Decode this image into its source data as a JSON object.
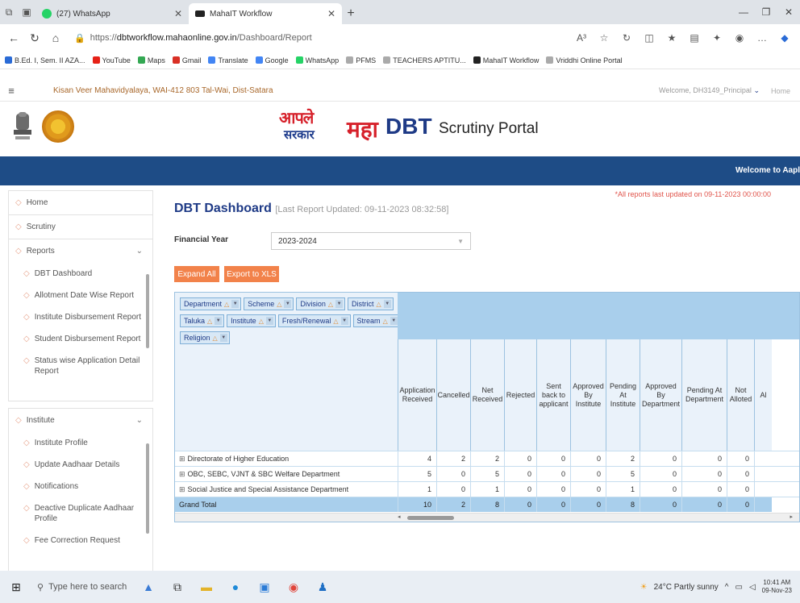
{
  "browser": {
    "tabs": [
      {
        "title": "(27) WhatsApp",
        "fav_color": "#25d366"
      },
      {
        "title": "MahaIT Workflow",
        "fav_color": "#222222"
      }
    ],
    "url_prefix": "https://",
    "url_host": "dbtworkflow.mahaonline.gov.in",
    "url_path": "/Dashboard/Report",
    "read_aloud": "A³",
    "bookmarks": [
      {
        "label": "B.Ed. I, Sem. II AZA...",
        "color": "#2a6bd6"
      },
      {
        "label": "YouTube",
        "color": "#e62117"
      },
      {
        "label": "Maps",
        "color": "#34a853"
      },
      {
        "label": "Gmail",
        "color": "#d93025"
      },
      {
        "label": "Translate",
        "color": "#4285f4"
      },
      {
        "label": "Google",
        "color": "#4285f4"
      },
      {
        "label": "WhatsApp",
        "color": "#25d366"
      },
      {
        "label": "PFMS",
        "color": "#aaaaaa"
      },
      {
        "label": "TEACHERS APTITU...",
        "color": "#aaaaaa"
      },
      {
        "label": "MahaIT Workflow",
        "color": "#222222"
      },
      {
        "label": "Vriddhi Online Portal",
        "color": "#aaaaaa"
      }
    ]
  },
  "header": {
    "college": "Kisan Veer Mahavidyalaya, WAI-412 803 Tal-Wai, Dist-Satara",
    "welcome": "Welcome, DH3149_Principal",
    "home": "Home",
    "logo_line1": "आपले",
    "logo_line2": "सरकार",
    "logo_maha": "महा",
    "logo_dbt": "DBT",
    "portal_name": "Scrutiny Portal",
    "marquee": "Welcome to Aapl"
  },
  "sidebar": {
    "home": "Home",
    "scrutiny": "Scrutiny",
    "reports": "Reports",
    "report_items": [
      "DBT Dashboard",
      "Allotment Date Wise Report",
      "Institute Disbursement Report",
      "Student Disbursement Report",
      "Status wise Application Detail Report"
    ],
    "institute": "Institute",
    "institute_items": [
      "Institute Profile",
      "Update Aadhaar Details",
      "Notifications",
      "Deactive Duplicate Aadhaar Profile",
      "Fee Correction Request"
    ]
  },
  "main": {
    "note": "*All reports last updated on 09-11-2023 00:00:00",
    "title": "DBT Dashboard",
    "subtitle": "[Last Report Updated: 09-11-2023 08:32:58]",
    "fy_label": "Financial Year",
    "fy_value": "2023-2024",
    "expand_all": "Expand All",
    "export": "Export to XLS"
  },
  "pivot": {
    "filters_row1": [
      "Department",
      "Scheme",
      "Division",
      "District"
    ],
    "filters_row2": [
      "Taluka",
      "Institute",
      "Fresh/Renewal",
      "Stream"
    ],
    "filters_row3": [
      "Religion"
    ],
    "columns": [
      "Application Received",
      "Cancelled",
      "Net Received",
      "Rejected",
      "Sent back to applicant",
      "Approved By Institute",
      "Pending At Institute",
      "Approved By Department",
      "Pending At Department",
      "Not Alloted",
      "Al"
    ],
    "rows": [
      {
        "label": "Directorate of Higher Education",
        "values": [
          "4",
          "2",
          "2",
          "0",
          "0",
          "0",
          "2",
          "0",
          "0",
          "0",
          ""
        ]
      },
      {
        "label": "OBC, SEBC, VJNT & SBC Welfare Department",
        "values": [
          "5",
          "0",
          "5",
          "0",
          "0",
          "0",
          "5",
          "0",
          "0",
          "0",
          ""
        ]
      },
      {
        "label": "Social Justice and Special Assistance Department",
        "values": [
          "1",
          "0",
          "1",
          "0",
          "0",
          "0",
          "1",
          "0",
          "0",
          "0",
          ""
        ]
      }
    ],
    "total": {
      "label": "Grand Total",
      "values": [
        "10",
        "2",
        "8",
        "0",
        "0",
        "0",
        "8",
        "0",
        "0",
        "0",
        ""
      ]
    }
  },
  "taskbar": {
    "search_placeholder": "Type here to search",
    "weather": "24°C  Partly sunny",
    "time": "10:41 AM",
    "date": "09-Nov-23"
  }
}
